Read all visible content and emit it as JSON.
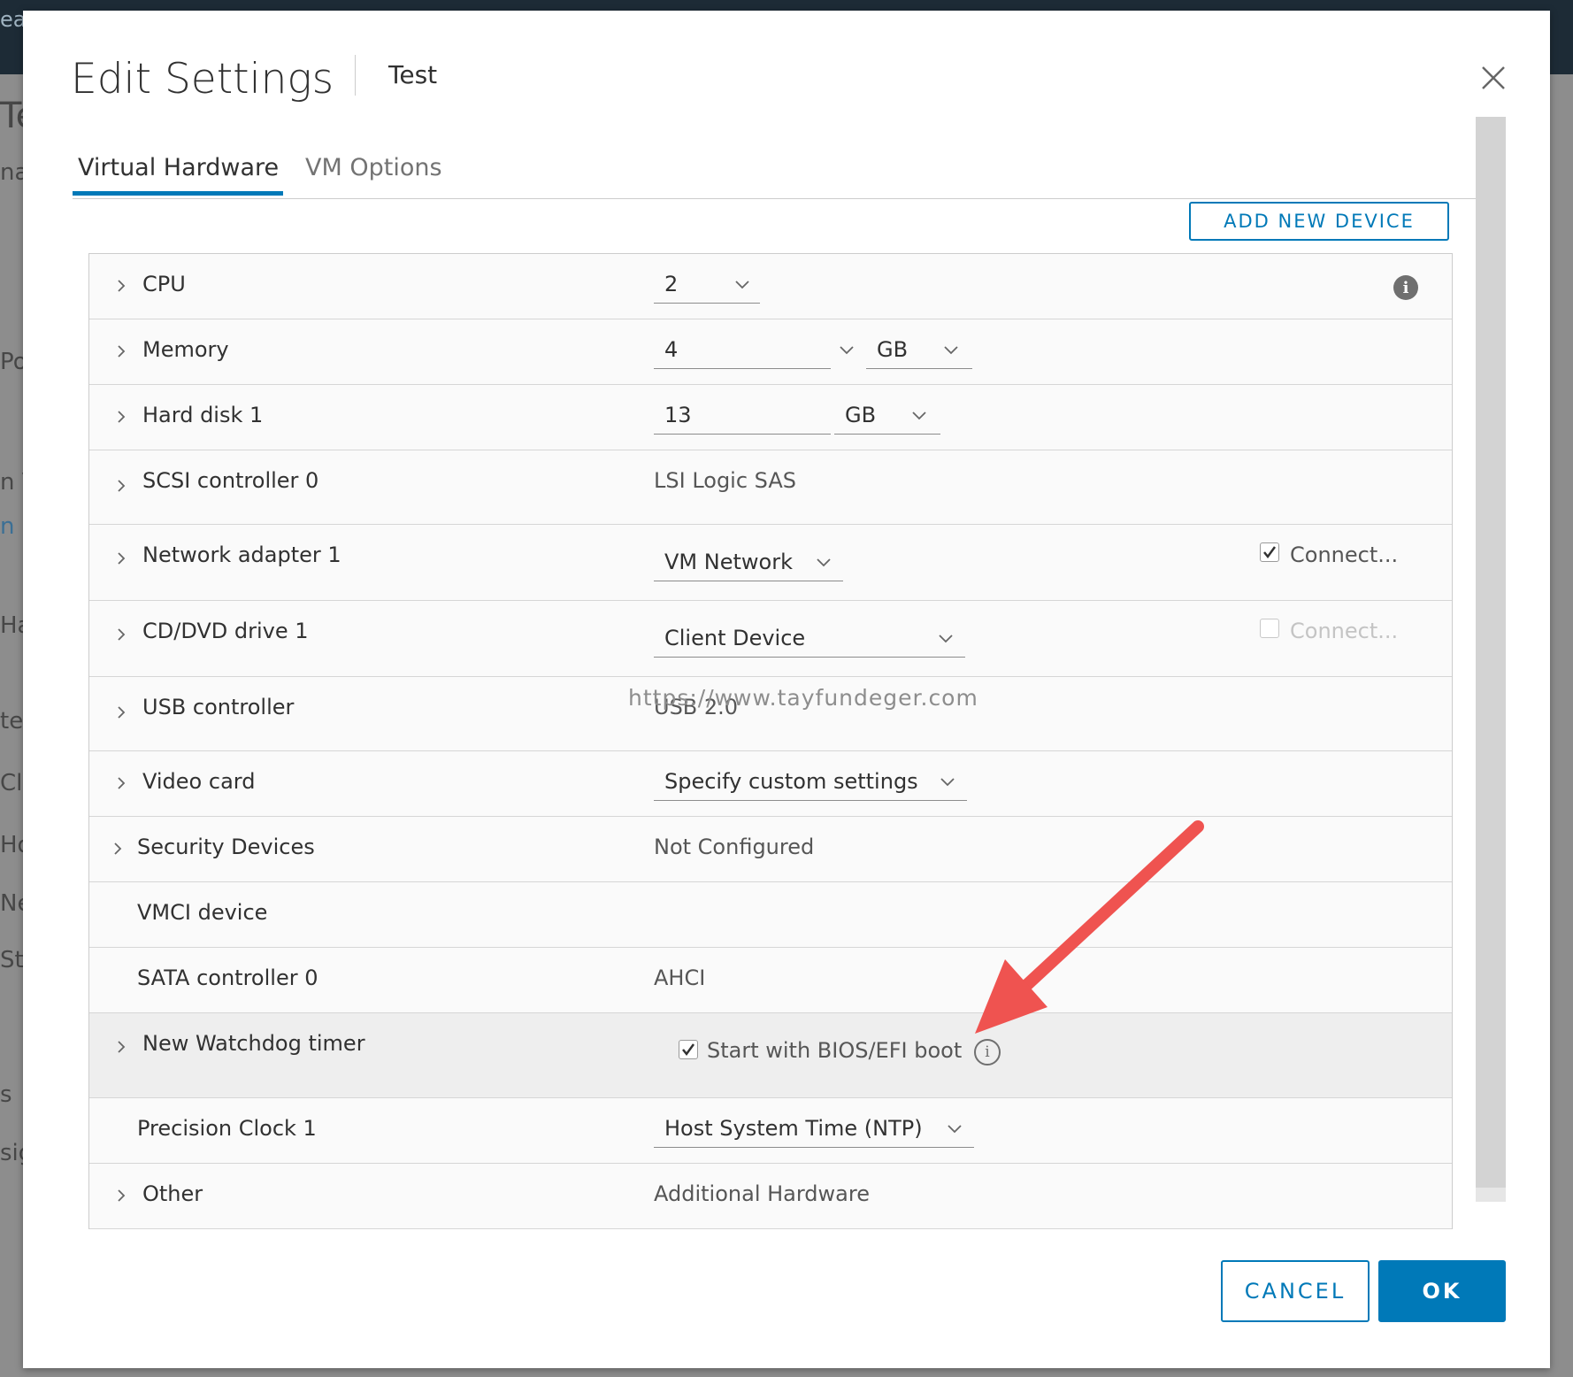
{
  "background": {
    "fragments": [
      "ea",
      "Te",
      "na",
      "Po",
      "n V",
      "n R",
      "Ha",
      "te",
      "Cl",
      "Ho",
      "Ne",
      "St",
      "s",
      "sig"
    ]
  },
  "dialog": {
    "title": "Edit Settings",
    "subtitle": "Test",
    "close_icon": "close-icon"
  },
  "tabs": [
    {
      "label": "Virtual Hardware",
      "active": true
    },
    {
      "label": "VM Options",
      "active": false
    }
  ],
  "add_device_label": "ADD NEW DEVICE",
  "devices": {
    "cpu": {
      "label": "CPU",
      "value": "2"
    },
    "memory": {
      "label": "Memory",
      "value": "4",
      "unit": "GB"
    },
    "hard_disk": {
      "label": "Hard disk 1",
      "value": "13",
      "unit": "GB"
    },
    "scsi": {
      "label": "SCSI controller 0",
      "value": "LSI Logic SAS"
    },
    "network": {
      "label": "Network adapter 1",
      "value": "VM Network",
      "connect_label": "Connect...",
      "connect_checked": true
    },
    "cddvd": {
      "label": "CD/DVD drive 1",
      "value": "Client Device",
      "connect_label": "Connect...",
      "connect_checked": false
    },
    "usb": {
      "label": "USB controller",
      "value": "USB 2.0"
    },
    "video": {
      "label": "Video card",
      "value": "Specify custom settings"
    },
    "security": {
      "label": "Security Devices",
      "value": "Not Configured"
    },
    "vmci": {
      "label": "VMCI device"
    },
    "sata": {
      "label": "SATA controller 0",
      "value": "AHCI"
    },
    "watchdog": {
      "label": "New Watchdog timer",
      "checkbox_label": "Start with BIOS/EFI boot",
      "checked": true
    },
    "clock": {
      "label": "Precision Clock 1",
      "value": "Host System Time (NTP)"
    },
    "other": {
      "label": "Other",
      "value": "Additional Hardware"
    }
  },
  "watermark": "https://www.tayfundeger.com",
  "footer": {
    "cancel_label": "CANCEL",
    "ok_label": "OK"
  },
  "colors": {
    "accent": "#0079b8",
    "annotation_arrow": "#ef5350"
  }
}
